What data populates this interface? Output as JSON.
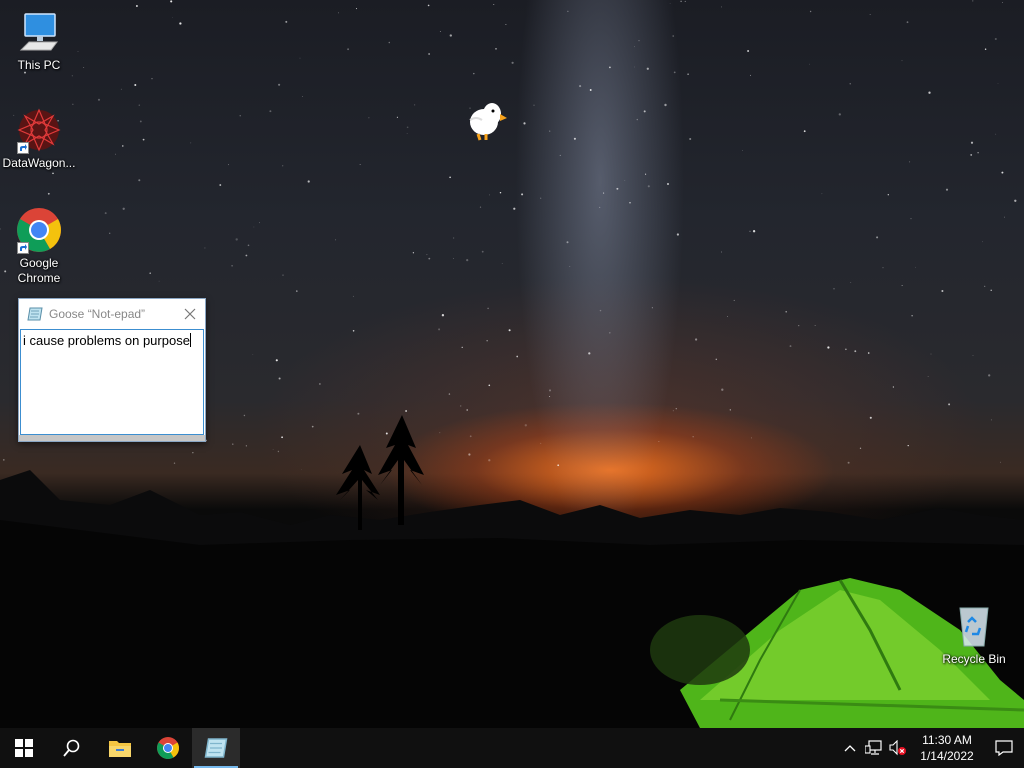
{
  "desktop": {
    "icons": [
      {
        "label": "This PC"
      },
      {
        "label": "DataWagon..."
      },
      {
        "label": "Google Chrome"
      },
      {
        "label": "Recycle Bin"
      }
    ]
  },
  "notepad": {
    "title": "Goose “Not-epad”",
    "text": "i cause problems on purpose"
  },
  "taskbar": {
    "clock_time": "11:30 AM",
    "clock_date": "1/14/2022"
  },
  "colors": {
    "taskbar": "#101010",
    "accent": "#76b9ed",
    "window_border": "#3c8ed0"
  }
}
